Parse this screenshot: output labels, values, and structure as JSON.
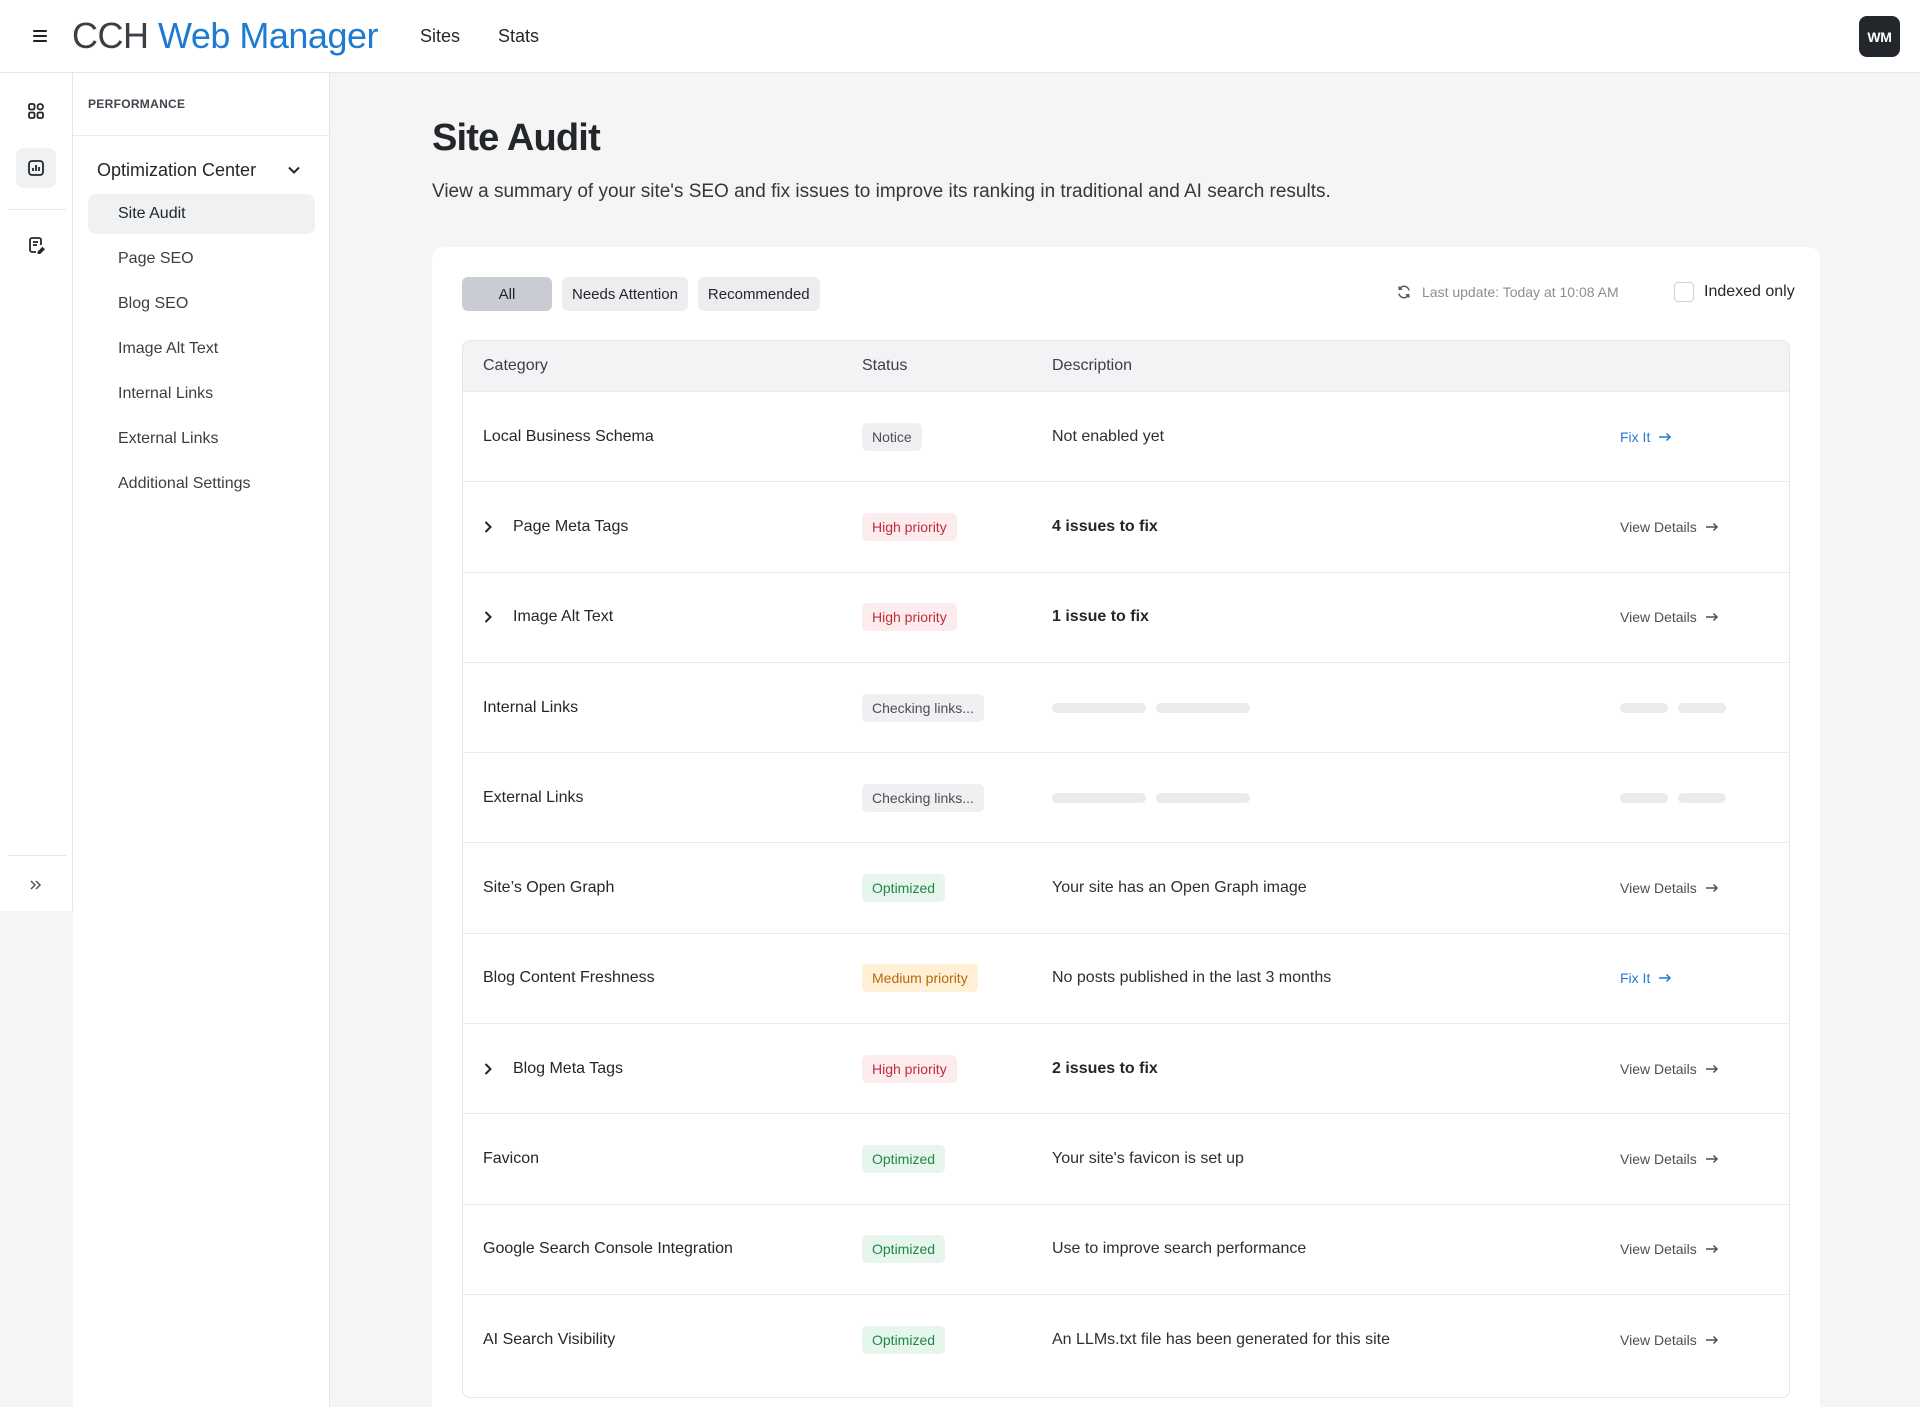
{
  "app": {
    "logo_part1": "CCH",
    "logo_part2": "Web Manager",
    "nav": [
      "Sites",
      "Stats"
    ],
    "avatar": "WM"
  },
  "sidebar": {
    "section_label": "PERFORMANCE",
    "group_title": "Optimization Center",
    "items": [
      {
        "label": "Site Audit"
      },
      {
        "label": "Page SEO"
      },
      {
        "label": "Blog SEO"
      },
      {
        "label": "Image Alt Text"
      },
      {
        "label": "Internal Links"
      },
      {
        "label": "External Links"
      },
      {
        "label": "Additional Settings"
      }
    ]
  },
  "page": {
    "title": "Site Audit",
    "subtitle": "View a summary of your site's SEO and fix issues to improve its ranking in traditional and AI search results."
  },
  "filters": [
    "All",
    "Needs Attention",
    "Recommended"
  ],
  "last_update": "Last update: Today at 10:08 AM",
  "indexed_label": "Indexed only",
  "table": {
    "headers": [
      "Category",
      "Status",
      "Description"
    ],
    "rows": [
      {
        "category": "Local Business Schema",
        "status": "Notice",
        "description": "Not enabled yet",
        "action": "Fix It"
      },
      {
        "category": "Page Meta Tags",
        "status": "High priority",
        "description": "4 issues to fix",
        "action": "View Details"
      },
      {
        "category": "Image Alt Text",
        "status": "High priority",
        "description": "1 issue to fix",
        "action": "View Details"
      },
      {
        "category": "Internal Links",
        "status": "Checking links...",
        "description": "",
        "action": ""
      },
      {
        "category": "External Links",
        "status": "Checking links...",
        "description": "",
        "action": ""
      },
      {
        "category": "Site’s Open Graph",
        "status": "Optimized",
        "description": "Your site has an Open Graph image",
        "action": "View Details"
      },
      {
        "category": "Blog Content Freshness",
        "status": "Medium priority",
        "description": "No posts published in the last 3 months",
        "action": "Fix It"
      },
      {
        "category": "Blog Meta Tags",
        "status": "High priority",
        "description": "2 issues to fix",
        "action": "View Details"
      },
      {
        "category": "Favicon",
        "status": "Optimized",
        "description": "Your site's favicon is set up",
        "action": "View Details"
      },
      {
        "category": "Google Search Console Integration",
        "status": "Optimized",
        "description": "Use to improve search performance",
        "action": "View Details"
      },
      {
        "category": "AI Search Visibility",
        "status": "Optimized",
        "description": "An LLMs.txt file has been generated for this site",
        "action": "View Details"
      }
    ]
  },
  "colors": {
    "accent": "#1f7bd1",
    "high": "#c22b3c",
    "medium": "#b66a0c",
    "optimized": "#1f8747"
  }
}
